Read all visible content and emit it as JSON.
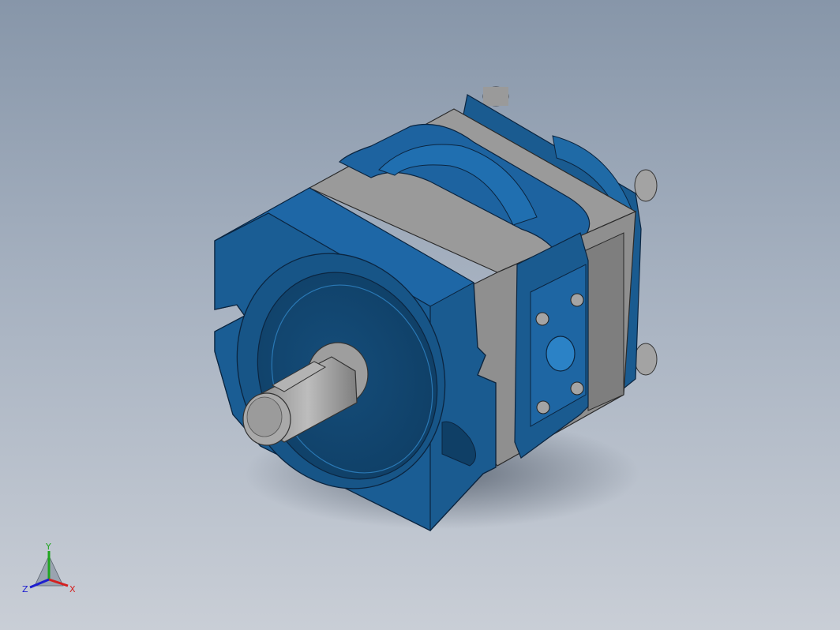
{
  "viewport": {
    "colors": {
      "bg_top": "#8796a9",
      "bg_bottom": "#c9ced6",
      "body_blue": "#1b5d92",
      "steel": "#9c9c9c"
    }
  },
  "triad": {
    "x_label": "X",
    "y_label": "Y",
    "z_label": "Z",
    "colors": {
      "x": "#d42020",
      "y": "#1fa51f",
      "z": "#1d1ecf"
    }
  },
  "model": {
    "icon": "gear-pump-3d-model"
  }
}
